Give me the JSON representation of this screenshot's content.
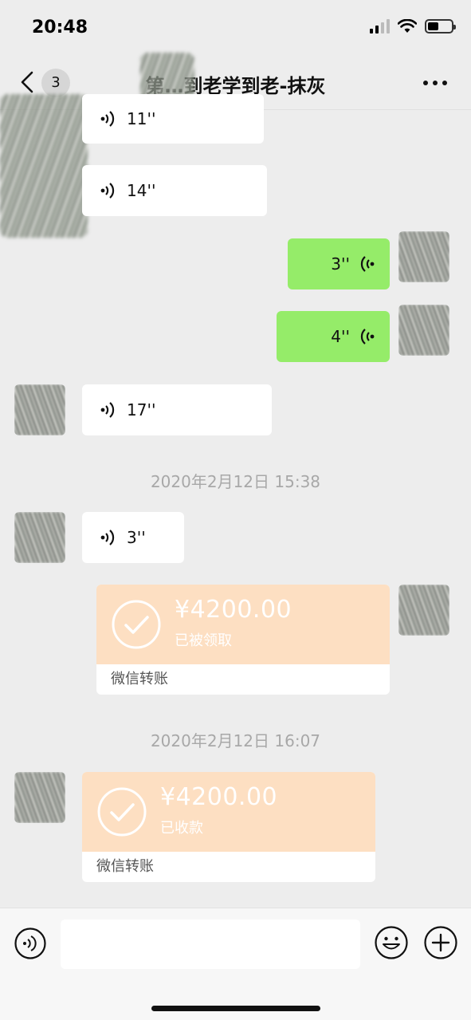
{
  "status_bar": {
    "time": "20:48"
  },
  "nav": {
    "unread_count": "3",
    "title": "第…到老学到老-抹灰"
  },
  "messages": [
    {
      "type": "voice",
      "direction": "in",
      "duration": "11''"
    },
    {
      "type": "voice",
      "direction": "in",
      "duration": "14''"
    },
    {
      "type": "voice",
      "direction": "out",
      "duration": "3''"
    },
    {
      "type": "voice",
      "direction": "out",
      "duration": "4''"
    },
    {
      "type": "voice",
      "direction": "in",
      "duration": "17''"
    },
    {
      "type": "timestamp",
      "text": "2020年2月12日 15:38"
    },
    {
      "type": "voice",
      "direction": "in",
      "duration": "3''"
    },
    {
      "type": "transfer",
      "direction": "out",
      "amount": "¥4200.00",
      "status": "已被领取",
      "label": "微信转账"
    },
    {
      "type": "timestamp",
      "text": "2020年2月12日 16:07"
    },
    {
      "type": "transfer",
      "direction": "in",
      "amount": "¥4200.00",
      "status": "已收款",
      "label": "微信转账"
    }
  ],
  "input": {
    "placeholder": ""
  },
  "colors": {
    "outgoing_bubble": "#95ec69",
    "transfer_card": "#fddfc2",
    "background": "#ededed"
  },
  "icons": [
    "back-icon",
    "more-icon",
    "voice-icon",
    "check-icon",
    "emoji-icon",
    "plus-icon"
  ]
}
